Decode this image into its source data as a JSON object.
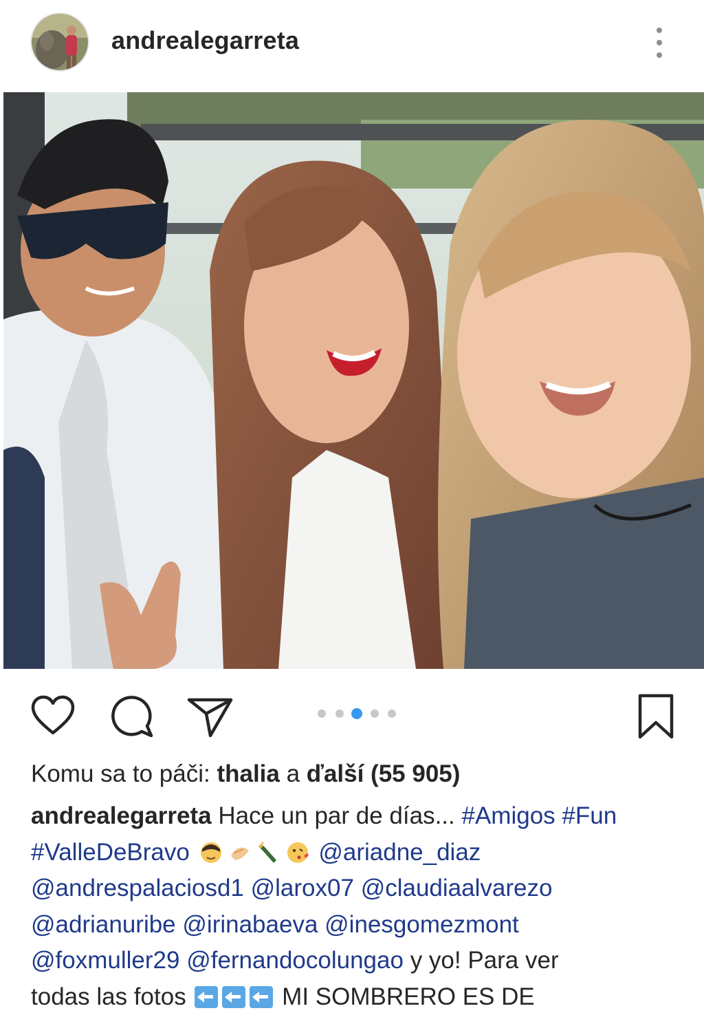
{
  "post": {
    "username": "andrealegarreta",
    "likes_prefix": "Komu sa to páči:",
    "likes_first": "thalia",
    "likes_join": "a",
    "likes_rest": "ďalší (55 905)",
    "carousel": {
      "total": 5,
      "active": 3
    },
    "caption": {
      "username": "andrealegarreta",
      "text_1": "Hace un par de días...",
      "tag_1": "#Amigos",
      "tag_2": "#Fun",
      "tag_3": "#ValleDeBravo",
      "m1": "@ariadne_diaz",
      "m2": "@andrespalaciosd1",
      "m3": "@larox07",
      "m4": "@claudiaalvarezo",
      "m5": "@adrianuribe",
      "m6": "@irinabaeva",
      "m7": "@inesgomezmont",
      "m8": "@foxmuller29",
      "m9": "@fernandocolungao",
      "text_2": "y yo! Para ver",
      "text_3": "todas las fotos",
      "text_4": "MI SOMBRERO ES DE"
    }
  },
  "colors": {
    "accent": "#3897f0",
    "link": "#1f3a8a",
    "text": "#262626",
    "muted": "#8e8e8e"
  },
  "icons": [
    "more-vertical-icon",
    "user-tag-icon",
    "heart-icon",
    "comment-icon",
    "share-icon",
    "bookmark-icon",
    "left-arrow-emoji-icon"
  ]
}
